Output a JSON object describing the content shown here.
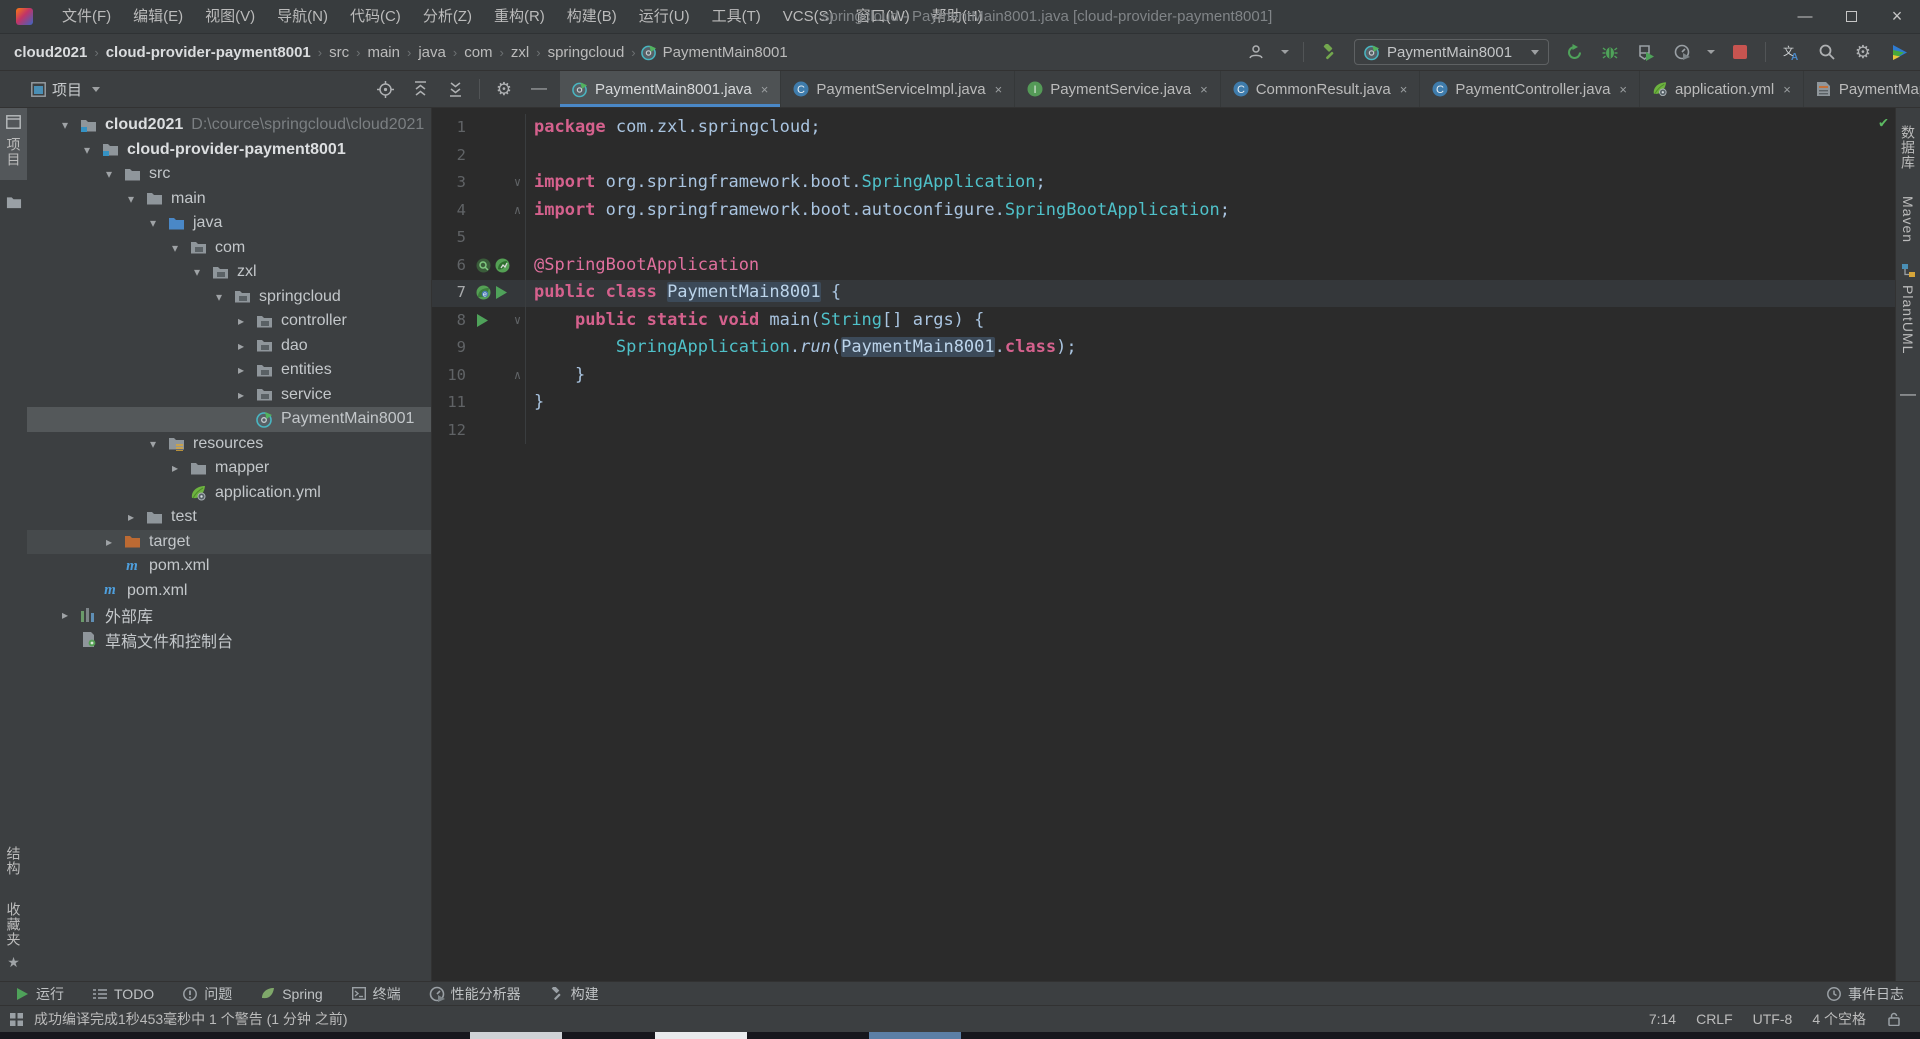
{
  "colors": {
    "accent_blue": "#4A88C7",
    "keyword_pink": "#d5618d",
    "class_teal": "#4fc1c9",
    "plain_blue": "#a9c4e0",
    "annotation_pink": "#e0709e",
    "run_green": "#4fa25a",
    "stop_red": "#c75450",
    "selection_gray": "#54585a",
    "editor_bg": "#2b2b2b",
    "frame_bg": "#3c3f41"
  },
  "window": {
    "title": "springcloud - PaymentMain8001.java [cloud-provider-payment8001]",
    "minimize": "—",
    "close": "×"
  },
  "menu": {
    "items": [
      "文件(F)",
      "编辑(E)",
      "视图(V)",
      "导航(N)",
      "代码(C)",
      "分析(Z)",
      "重构(R)",
      "构建(B)",
      "运行(U)",
      "工具(T)",
      "VCS(S)",
      "窗口(W)",
      "帮助(H)"
    ]
  },
  "breadcrumbs": {
    "items": [
      {
        "label": "cloud2021",
        "bold": true
      },
      {
        "label": "cloud-provider-payment8001",
        "bold": true
      },
      {
        "label": "src"
      },
      {
        "label": "main"
      },
      {
        "label": "java"
      },
      {
        "label": "com"
      },
      {
        "label": "zxl"
      },
      {
        "label": "springcloud"
      },
      {
        "label": "PaymentMain8001",
        "icon": "spring-boot-file-icon"
      }
    ],
    "separator": "›"
  },
  "run_widget": {
    "config_name": "PaymentMain8001"
  },
  "project_panel": {
    "title": "项目",
    "tree": [
      {
        "depth": 0,
        "chevron": "open",
        "icon": "module-folder-icon",
        "label": "cloud2021",
        "suffix": "D:\\cource\\springcloud\\cloud2021",
        "bold": true
      },
      {
        "depth": 1,
        "chevron": "open",
        "icon": "module-folder-icon",
        "label": "cloud-provider-payment8001",
        "bold": true
      },
      {
        "depth": 2,
        "chevron": "open",
        "icon": "folder-icon",
        "label": "src"
      },
      {
        "depth": 3,
        "chevron": "open",
        "icon": "folder-icon",
        "label": "main"
      },
      {
        "depth": 4,
        "chevron": "open",
        "icon": "java-source-folder-icon",
        "label": "java"
      },
      {
        "depth": 5,
        "chevron": "open",
        "icon": "package-folder-icon",
        "label": "com"
      },
      {
        "depth": 6,
        "chevron": "open",
        "icon": "package-folder-icon",
        "label": "zxl"
      },
      {
        "depth": 7,
        "chevron": "open",
        "icon": "package-folder-icon",
        "label": "springcloud"
      },
      {
        "depth": 8,
        "chevron": "closed",
        "icon": "package-folder-icon",
        "label": "controller"
      },
      {
        "depth": 8,
        "chevron": "closed",
        "icon": "package-folder-icon",
        "label": "dao"
      },
      {
        "depth": 8,
        "chevron": "closed",
        "icon": "package-folder-icon",
        "label": "entities"
      },
      {
        "depth": 8,
        "chevron": "closed",
        "icon": "package-folder-icon",
        "label": "service"
      },
      {
        "depth": 8,
        "chevron": "none",
        "icon": "spring-boot-file-icon",
        "label": "PaymentMain8001",
        "state": "selected"
      },
      {
        "depth": 4,
        "chevron": "open",
        "icon": "resources-folder-icon",
        "label": "resources"
      },
      {
        "depth": 5,
        "chevron": "closed",
        "icon": "folder-icon",
        "label": "mapper"
      },
      {
        "depth": 5,
        "chevron": "none",
        "icon": "spring-leaf-icon",
        "label": "application.yml"
      },
      {
        "depth": 3,
        "chevron": "closed",
        "icon": "folder-icon",
        "label": "test"
      },
      {
        "depth": 2,
        "chevron": "closed",
        "icon": "target-folder-icon",
        "label": "target",
        "state": "hover"
      },
      {
        "depth": 2,
        "chevron": "none",
        "icon": "maven-icon",
        "label": "pom.xml"
      },
      {
        "depth": 1,
        "chevron": "none",
        "icon": "maven-icon",
        "label": "pom.xml"
      },
      {
        "depth": 0,
        "chevron": "closed",
        "icon": "external-libraries-icon",
        "label": "外部库"
      },
      {
        "depth": 0,
        "chevron": "none",
        "icon": "scratches-icon",
        "label": "草稿文件和控制台"
      }
    ]
  },
  "editor": {
    "tabs": [
      {
        "label": "PaymentMain8001.java",
        "icon": "spring-boot-file-icon",
        "active": true
      },
      {
        "label": "PaymentServiceImpl.java",
        "icon": "java-class-icon"
      },
      {
        "label": "PaymentService.java",
        "icon": "java-interface-icon"
      },
      {
        "label": "CommonResult.java",
        "icon": "java-class-icon"
      },
      {
        "label": "PaymentController.java",
        "icon": "java-class-icon"
      },
      {
        "label": "application.yml",
        "icon": "spring-leaf-icon"
      },
      {
        "label": "PaymentMap",
        "icon": "xml-file-icon",
        "chevron": true
      }
    ],
    "code_lines": [
      {
        "n": "1",
        "seg": [
          [
            "kw",
            "package"
          ],
          [
            "pln",
            " com.zxl.springcloud;"
          ]
        ]
      },
      {
        "n": "2",
        "seg": []
      },
      {
        "n": "3",
        "fold": "v",
        "seg": [
          [
            "kw",
            "import"
          ],
          [
            "pln",
            " org.springframework.boot."
          ],
          [
            "cls",
            "SpringApplication"
          ],
          [
            "pln",
            ";"
          ]
        ]
      },
      {
        "n": "4",
        "fold": "^",
        "seg": [
          [
            "kw",
            "import"
          ],
          [
            "pln",
            " org.springframework.boot.autoconfigure."
          ],
          [
            "cls",
            "SpringBootApplication"
          ],
          [
            "pln",
            ";"
          ]
        ]
      },
      {
        "n": "5",
        "seg": []
      },
      {
        "n": "6",
        "icons": [
          "spring-scan-icon",
          "spring-boot-gutter-icon"
        ],
        "seg": [
          [
            "ann",
            "@SpringBootApplication"
          ]
        ]
      },
      {
        "n": "7",
        "caret": true,
        "icons": [
          "spring-bean-icon",
          "run-gutter-icon"
        ],
        "seg": [
          [
            "kw",
            "public class "
          ],
          [
            "hl",
            "PaymentMain8001"
          ],
          [
            "pln",
            " {"
          ]
        ]
      },
      {
        "n": "8",
        "icons": [
          "run-gutter-icon"
        ],
        "fold": "v",
        "seg": [
          [
            "pln",
            "    "
          ],
          [
            "kw",
            "public static void"
          ],
          [
            "pln",
            " main("
          ],
          [
            "cls",
            "String"
          ],
          [
            "pln",
            "[] args) {"
          ]
        ]
      },
      {
        "n": "9",
        "seg": [
          [
            "pln",
            "        "
          ],
          [
            "cls",
            "SpringApplication"
          ],
          [
            "pln",
            "."
          ],
          [
            "it",
            "run"
          ],
          [
            "pln",
            "("
          ],
          [
            "hl",
            "PaymentMain8001"
          ],
          [
            "pln",
            "."
          ],
          [
            "kw",
            "class"
          ],
          [
            "pln",
            ");"
          ]
        ]
      },
      {
        "n": "10",
        "fold": "^",
        "seg": [
          [
            "pln",
            "    }"
          ]
        ]
      },
      {
        "n": "11",
        "seg": [
          [
            "pln",
            "}"
          ]
        ]
      },
      {
        "n": "12",
        "seg": []
      }
    ]
  },
  "bottom_tools": {
    "left": [
      {
        "icon": "run-icon",
        "label": "运行"
      },
      {
        "icon": "todo-icon",
        "label": "TODO"
      },
      {
        "icon": "problems-icon",
        "label": "问题"
      },
      {
        "icon": "spring-icon",
        "label": "Spring"
      },
      {
        "icon": "terminal-icon",
        "label": "终端"
      },
      {
        "icon": "profiler-icon",
        "label": "性能分析器"
      },
      {
        "icon": "build-icon",
        "label": "构建"
      }
    ],
    "right": {
      "icon": "event-log-icon",
      "label": "事件日志"
    }
  },
  "status_bar": {
    "message": "成功编译完成1秒453毫秒中 1 个警告 (1 分钟 之前)",
    "caret_position": "7:14",
    "line_separator": "CRLF",
    "encoding": "UTF-8",
    "indent": "4 个空格"
  },
  "left_stripe": {
    "project_tab": "项目",
    "bottom_tabs": [
      "结构",
      "收藏夹"
    ]
  },
  "right_stripe": {
    "tabs": [
      "数据库",
      "Maven",
      "PlantUML"
    ]
  }
}
